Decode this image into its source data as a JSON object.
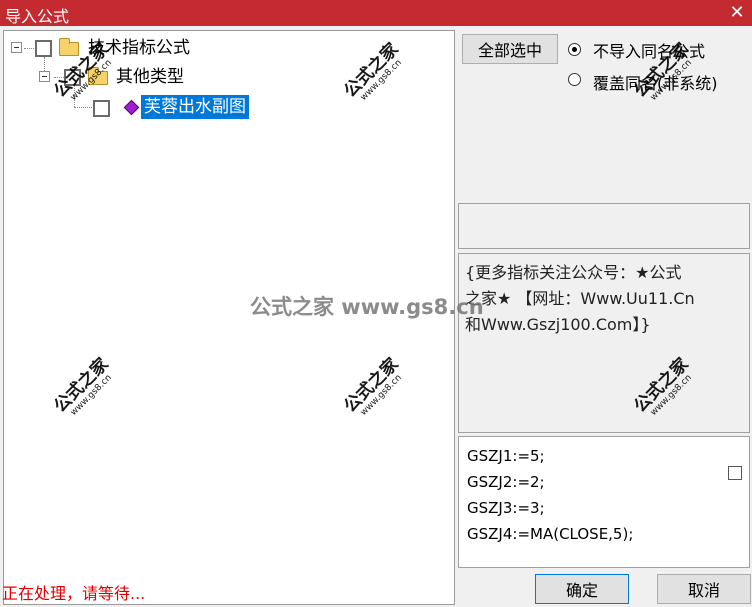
{
  "window": {
    "title": "导入公式",
    "close_glyph": "✕"
  },
  "tree": {
    "items": [
      {
        "label": "技术指标公式",
        "icon": "folder-icon",
        "checked": false
      },
      {
        "label": "其他类型",
        "icon": "folder-icon",
        "checked": false
      },
      {
        "label": "芙蓉出水副图",
        "icon": "gem-icon",
        "checked": false,
        "selected": true
      }
    ]
  },
  "actions": {
    "select_all": "全部选中",
    "options": [
      {
        "label": "不导入同名公式",
        "checked": true
      },
      {
        "label": "覆盖同名(非系统)",
        "checked": false
      }
    ],
    "ok": "确定",
    "cancel": "取消"
  },
  "info": {
    "lines": [
      "{更多指标关注公众号：★公式",
      "之家★ 【网址：Www.Uu11.Cn",
      "和Www.Gszj100.Com】}"
    ]
  },
  "code": {
    "lines": [
      "GSZJ1:=5;",
      "GSZJ2:=2;",
      "GSZJ3:=3;",
      "GSZJ4:=MA(CLOSE,5);"
    ]
  },
  "status": {
    "text": "正在处理，请等待..."
  },
  "watermark": {
    "cn": "公式之家",
    "url": "www.gs8.cn",
    "center": "公式之家 www.gs8.cn"
  },
  "colors": {
    "titlebar": "#c42b30",
    "selection": "#0078d7",
    "status": "#e00000",
    "folder": "#f6d36a",
    "gem": "#a020d0"
  }
}
